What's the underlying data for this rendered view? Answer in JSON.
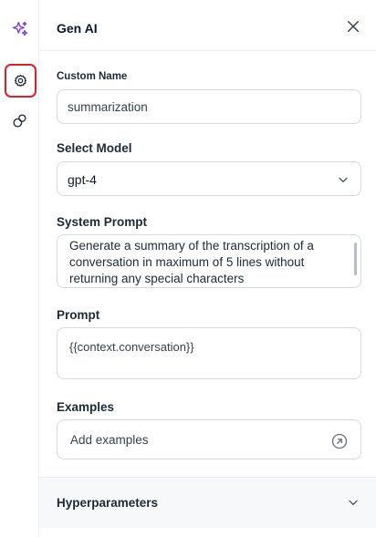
{
  "header": {
    "title": "Gen AI"
  },
  "custom_name": {
    "label": "Custom Name",
    "value": "summarization"
  },
  "model": {
    "label": "Select Model",
    "selected": "gpt-4"
  },
  "system_prompt": {
    "label": "System Prompt",
    "line1": "Generate a summary of the transcription of a",
    "line2": "conversation in maximum of  5 lines without",
    "line3": "returning any special characters"
  },
  "prompt": {
    "label": "Prompt",
    "value": "{{context.conversation}}"
  },
  "examples": {
    "label": "Examples",
    "placeholder": "Add examples"
  },
  "hyperparameters": {
    "label": "Hyperparameters"
  },
  "colors": {
    "accent": "#7c3aed",
    "highlight": "#e11d2a",
    "border": "#d6dae0"
  },
  "icons": {
    "rail": [
      "sparkle-icon",
      "settings-icon",
      "link-icon"
    ],
    "header": [
      "close-icon"
    ]
  }
}
